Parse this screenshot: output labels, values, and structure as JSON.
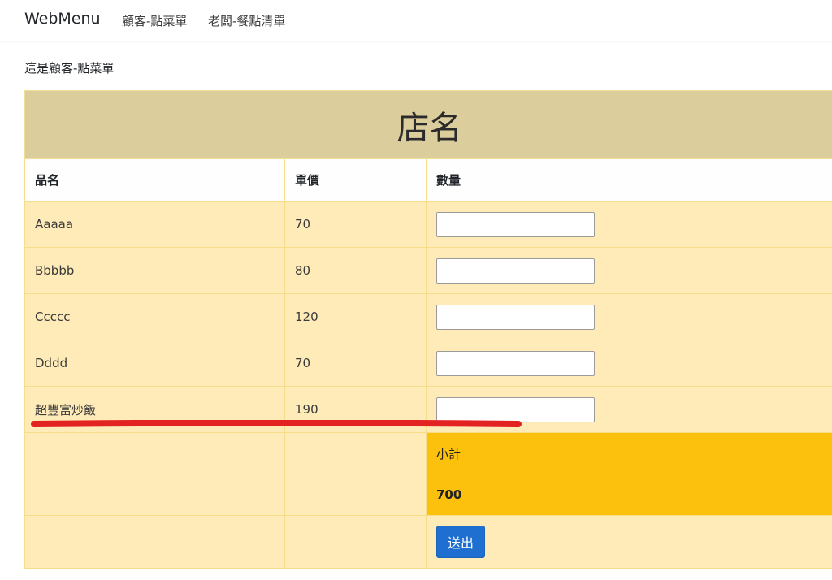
{
  "navbar": {
    "brand": "WebMenu",
    "links": [
      {
        "label": "顧客-點菜單"
      },
      {
        "label": "老闆-餐點清單"
      }
    ]
  },
  "intro_text": "這是顧客-點菜單",
  "menu": {
    "store_name": "店名",
    "columns": [
      "品名",
      "單價",
      "數量"
    ],
    "items": [
      {
        "name": "Aaaaa",
        "price": "70",
        "quantity": ""
      },
      {
        "name": "Bbbbb",
        "price": "80",
        "quantity": ""
      },
      {
        "name": "Ccccc",
        "price": "120",
        "quantity": ""
      },
      {
        "name": "Dddd",
        "price": "70",
        "quantity": ""
      },
      {
        "name": "超豐富炒飯",
        "price": "190",
        "quantity": ""
      }
    ],
    "subtotal_label": "小計",
    "subtotal_value": "700",
    "submit_label": "送出"
  },
  "colors": {
    "title_bg": "#dccd9c",
    "row_bg": "#feebb7",
    "subtotal_bg": "#fcc10c",
    "button_bg": "#1e6fcf",
    "annotation": "#e32222"
  }
}
